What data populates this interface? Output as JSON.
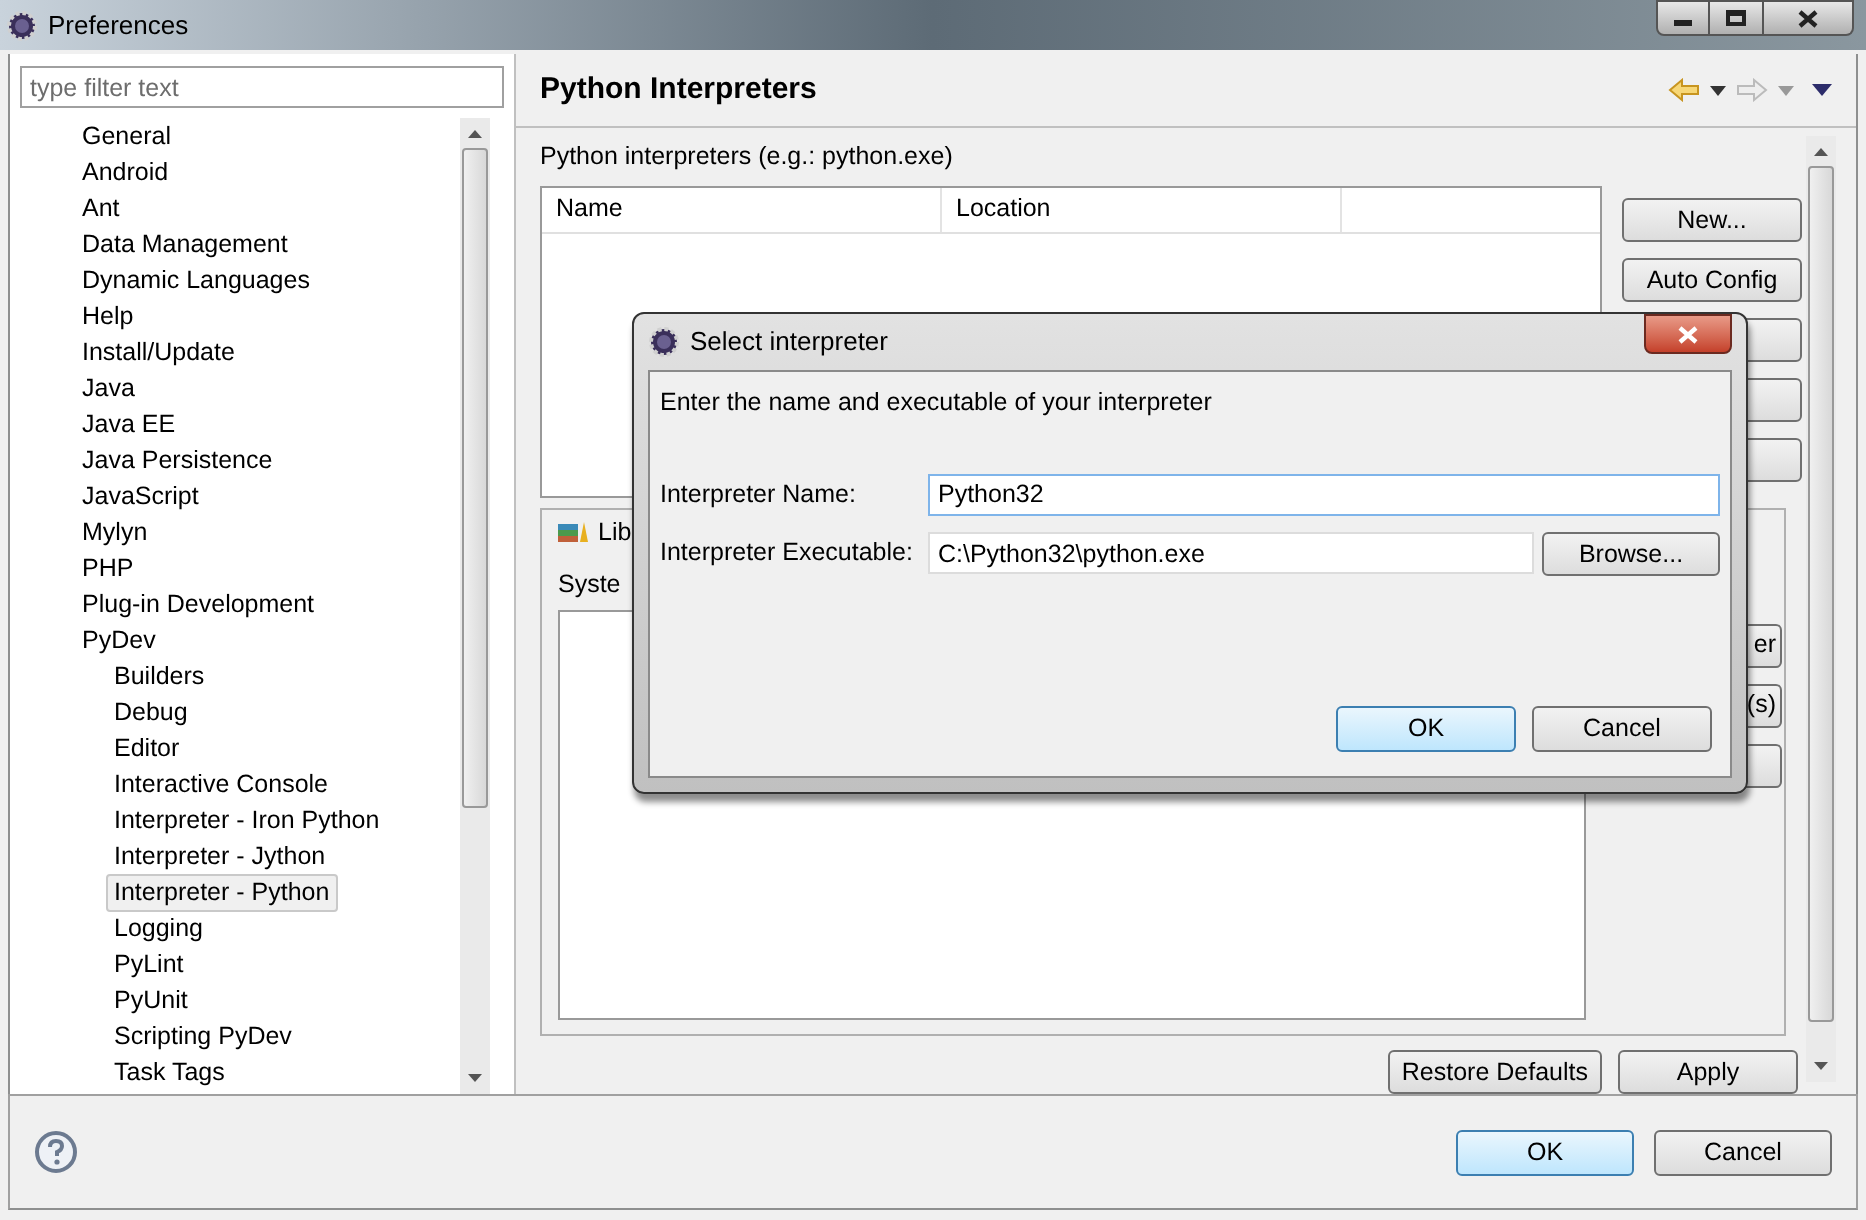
{
  "window": {
    "title": "Preferences"
  },
  "sidebar": {
    "filter": {
      "placeholder": "type filter text"
    },
    "items": [
      {
        "label": "General",
        "selected": false
      },
      {
        "label": "Android",
        "selected": false
      },
      {
        "label": "Ant",
        "selected": false
      },
      {
        "label": "Data Management",
        "selected": false
      },
      {
        "label": "Dynamic Languages",
        "selected": false
      },
      {
        "label": "Help",
        "selected": false
      },
      {
        "label": "Install/Update",
        "selected": false
      },
      {
        "label": "Java",
        "selected": false
      },
      {
        "label": "Java EE",
        "selected": false
      },
      {
        "label": "Java Persistence",
        "selected": false
      },
      {
        "label": "JavaScript",
        "selected": false
      },
      {
        "label": "Mylyn",
        "selected": false
      },
      {
        "label": "PHP",
        "selected": false
      },
      {
        "label": "Plug-in Development",
        "selected": false
      },
      {
        "label": "PyDev",
        "selected": false,
        "children": [
          {
            "label": "Builders",
            "selected": false
          },
          {
            "label": "Debug",
            "selected": false
          },
          {
            "label": "Editor",
            "selected": false
          },
          {
            "label": "Interactive Console",
            "selected": false
          },
          {
            "label": "Interpreter - Iron Python",
            "selected": false
          },
          {
            "label": "Interpreter - Jython",
            "selected": false
          },
          {
            "label": "Interpreter - Python",
            "selected": true
          },
          {
            "label": "Logging",
            "selected": false
          },
          {
            "label": "PyLint",
            "selected": false
          },
          {
            "label": "PyUnit",
            "selected": false
          },
          {
            "label": "Scripting PyDev",
            "selected": false
          },
          {
            "label": "Task Tags",
            "selected": false
          }
        ]
      }
    ]
  },
  "page": {
    "title": "Python Interpreters",
    "section_label": "Python interpreters (e.g.: python.exe)",
    "table": {
      "columns": [
        "Name",
        "Location"
      ]
    },
    "side_buttons": [
      "New...",
      "Auto Config"
    ],
    "libraries": {
      "tab_label": "Lib",
      "list_label": "Syste",
      "side_buttons": [
        "er",
        "(s)"
      ]
    },
    "footer_buttons": [
      "Restore Defaults",
      "Apply"
    ]
  },
  "dialog": {
    "title": "Select interpreter",
    "message": "Enter the name and executable of your interpreter",
    "fields": [
      {
        "label": "Interpreter Name:",
        "value": "Python32",
        "focused": true
      },
      {
        "label": "Interpreter Executable:",
        "value": "C:\\Python32\\python.exe",
        "focused": false
      }
    ],
    "browse_button": "Browse...",
    "buttons": [
      {
        "label": "OK",
        "default": true
      },
      {
        "label": "Cancel",
        "default": false
      }
    ]
  },
  "buttons": [
    {
      "label": "OK",
      "default": true
    },
    {
      "label": "Cancel",
      "default": false
    }
  ]
}
